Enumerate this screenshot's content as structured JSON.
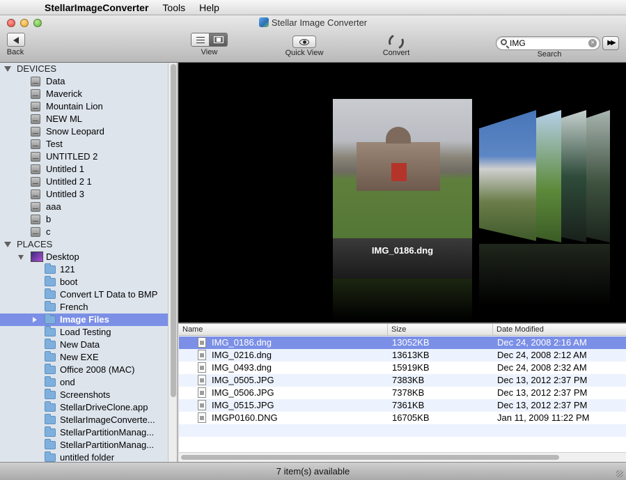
{
  "menubar": {
    "app_name": "StellarImageConverter",
    "items": [
      "Tools",
      "Help"
    ]
  },
  "window": {
    "title": "Stellar Image Converter"
  },
  "toolbar": {
    "back_label": "Back",
    "view_label": "View",
    "quick_view_label": "Quick View",
    "convert_label": "Convert",
    "search_label": "Search",
    "search_value": "IMG"
  },
  "sidebar": {
    "devices_label": "DEVICES",
    "devices": [
      "Data",
      "Maverick",
      "Mountain Lion",
      "NEW ML",
      "Snow Leopard",
      "Test",
      "UNTITLED 2",
      "Untitled 1",
      "Untitled 2 1",
      "Untitled 3",
      "aaa",
      "b",
      "c"
    ],
    "places_label": "PLACES",
    "desktop_label": "Desktop",
    "folders": [
      "121",
      "boot",
      "Convert LT Data to BMP",
      "French",
      "Image Files",
      "Load Testing",
      "New Data",
      "New EXE",
      "Office 2008 (MAC)",
      "ond",
      "Screenshots",
      "StellarDriveClone.app",
      "StellarImageConverte...",
      "StellarPartitionManag...",
      "StellarPartitionManag...",
      "untitled folder"
    ],
    "selected_folder_index": 4
  },
  "coverflow": {
    "caption": "IMG_0186.dng"
  },
  "table": {
    "columns": {
      "name": "Name",
      "size": "Size",
      "date": "Date Modified"
    },
    "rows": [
      {
        "name": "IMG_0186.dng",
        "size": "13052KB",
        "date": "Dec 24, 2008 2:16 AM"
      },
      {
        "name": "IMG_0216.dng",
        "size": "13613KB",
        "date": "Dec 24, 2008 2:12 AM"
      },
      {
        "name": "IMG_0493.dng",
        "size": "15919KB",
        "date": "Dec 24, 2008 2:32 AM"
      },
      {
        "name": "IMG_0505.JPG",
        "size": "7383KB",
        "date": "Dec 13, 2012 2:37 PM"
      },
      {
        "name": "IMG_0506.JPG",
        "size": "7378KB",
        "date": "Dec 13, 2012 2:37 PM"
      },
      {
        "name": "IMG_0515.JPG",
        "size": "7361KB",
        "date": "Dec 13, 2012 2:37 PM"
      },
      {
        "name": "IMGP0160.DNG",
        "size": "16705KB",
        "date": "Jan 11, 2009 11:22 PM"
      }
    ],
    "selected_row_index": 0
  },
  "status": {
    "text": "7 item(s) available"
  },
  "colors": {
    "selection": "#7b8fe6",
    "sidebar_bg": "#dde4ec",
    "alt_row": "#edf3fe"
  }
}
